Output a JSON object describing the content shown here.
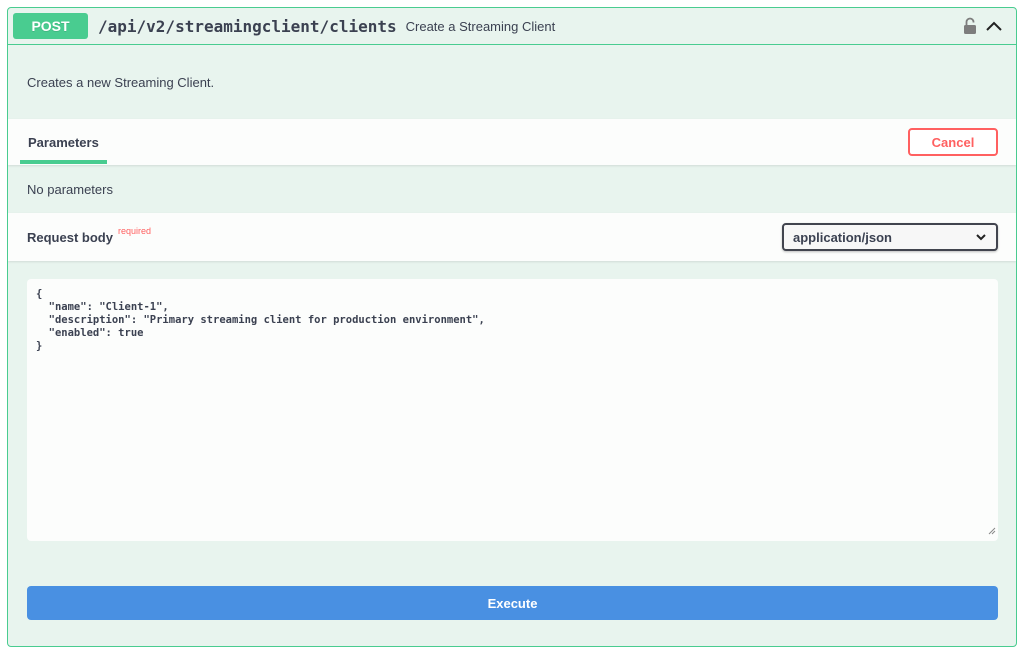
{
  "operation": {
    "method": "POST",
    "path": "/api/v2/streamingclient/clients",
    "summary": "Create a Streaming Client",
    "description": "Creates a new Streaming Client."
  },
  "parameters": {
    "tab_label": "Parameters",
    "cancel_label": "Cancel",
    "empty_text": "No parameters"
  },
  "request_body": {
    "title": "Request body",
    "required_label": "required",
    "content_type": "application/json",
    "body": "{\n  \"name\": \"Client-1\",\n  \"description\": \"Primary streaming client for production environment\",\n  \"enabled\": true\n}"
  },
  "execute_label": "Execute",
  "colors": {
    "post_green": "#49cc90",
    "panel_bg": "#e8f4ee",
    "cancel_red": "#ff6060",
    "execute_blue": "#4990e2"
  },
  "icons": {
    "lock": "unlocked-padlock-icon",
    "collapse": "chevron-up-icon",
    "select": "chevron-down-icon",
    "resize": "resize-grip-icon"
  }
}
